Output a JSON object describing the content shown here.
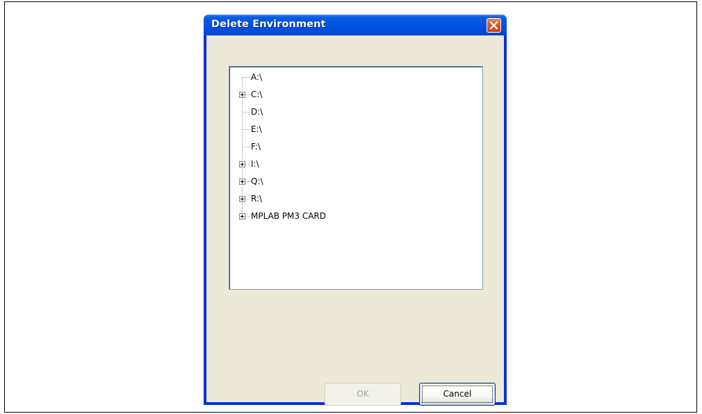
{
  "dialog": {
    "title": "Delete Environment",
    "close_icon": "close-icon"
  },
  "tree": {
    "items": [
      {
        "label": "A:\\",
        "expandable": false
      },
      {
        "label": "C:\\",
        "expandable": true
      },
      {
        "label": "D:\\",
        "expandable": false
      },
      {
        "label": "E:\\",
        "expandable": false
      },
      {
        "label": "F:\\",
        "expandable": false
      },
      {
        "label": "I:\\",
        "expandable": true
      },
      {
        "label": "Q:\\",
        "expandable": true
      },
      {
        "label": "R:\\",
        "expandable": true
      },
      {
        "label": "MPLAB PM3 CARD",
        "expandable": true
      }
    ]
  },
  "buttons": {
    "ok_label": "OK",
    "cancel_label": "Cancel"
  },
  "colors": {
    "titlebar": "#0355e0",
    "client": "#ece9d8",
    "close": "#e05a2b"
  }
}
